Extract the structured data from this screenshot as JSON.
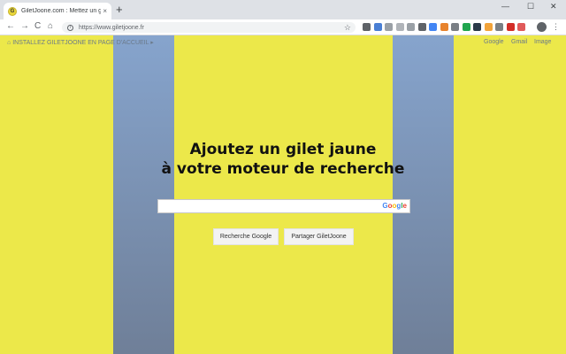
{
  "browser": {
    "tab_title": "GiletJoone.com : Mettez un gilet jaune",
    "tab_favicon_letter": "G",
    "tab_close_glyph": "×",
    "new_tab_glyph": "+",
    "url": "https://www.giletjoone.fr",
    "nav": {
      "back": "←",
      "forward": "→",
      "reload": "C",
      "home": "⌂"
    },
    "bookmark_glyph": "☆",
    "window": {
      "minimize": "—",
      "maximize": "☐",
      "close": "✕"
    },
    "menu_glyph": "⋮",
    "extension_icons": [
      {
        "name": "recycle-icon",
        "color": "#5f6368"
      },
      {
        "name": "calendar-icon",
        "color": "#4a7fd4"
      },
      {
        "name": "card-icon",
        "color": "#9aa0a6"
      },
      {
        "name": "chat-icon",
        "color": "#b0b4b9"
      },
      {
        "name": "camera-icon",
        "color": "#9aa0a6"
      },
      {
        "name": "download-icon",
        "color": "#5f6368"
      },
      {
        "name": "translate-icon",
        "color": "#4285f4"
      },
      {
        "name": "palette-icon",
        "color": "#e8832c"
      },
      {
        "name": "grid-icon",
        "color": "#7a7f85"
      },
      {
        "name": "evernote-icon",
        "color": "#21a64f"
      },
      {
        "name": "s-icon",
        "color": "#2b3a4a"
      },
      {
        "name": "pinwheel-icon",
        "color": "#f2a33a"
      },
      {
        "name": "slash-icon",
        "color": "#7a7f85"
      },
      {
        "name": "lastpass-icon",
        "color": "#d32d27"
      },
      {
        "name": "record-icon",
        "color": "#e05a5a"
      }
    ]
  },
  "page": {
    "install_label": "INSTALLEZ GILETJOONE EN PAGE D'ACCUEIL",
    "install_home_glyph": "⌂",
    "install_arrow_glyph": "▸",
    "links": {
      "google": "Google",
      "gmail": "Gmail",
      "images": "Image"
    },
    "headline_line1": "Ajoutez un gilet jaune",
    "headline_line2": "à votre moteur de recherche",
    "search": {
      "value": "",
      "placeholder": ""
    },
    "google_logo": "Google",
    "buttons": {
      "search": "Recherche Google",
      "share": "Partager GiletJoone"
    },
    "colors": {
      "yellow": "#ece84a",
      "blue_top": "#86a4cd",
      "blue_bottom": "#6f7f98",
      "google_blue": "#4285f4",
      "google_red": "#ea4335",
      "google_yellow": "#fbbc05",
      "google_green": "#34a853"
    }
  }
}
